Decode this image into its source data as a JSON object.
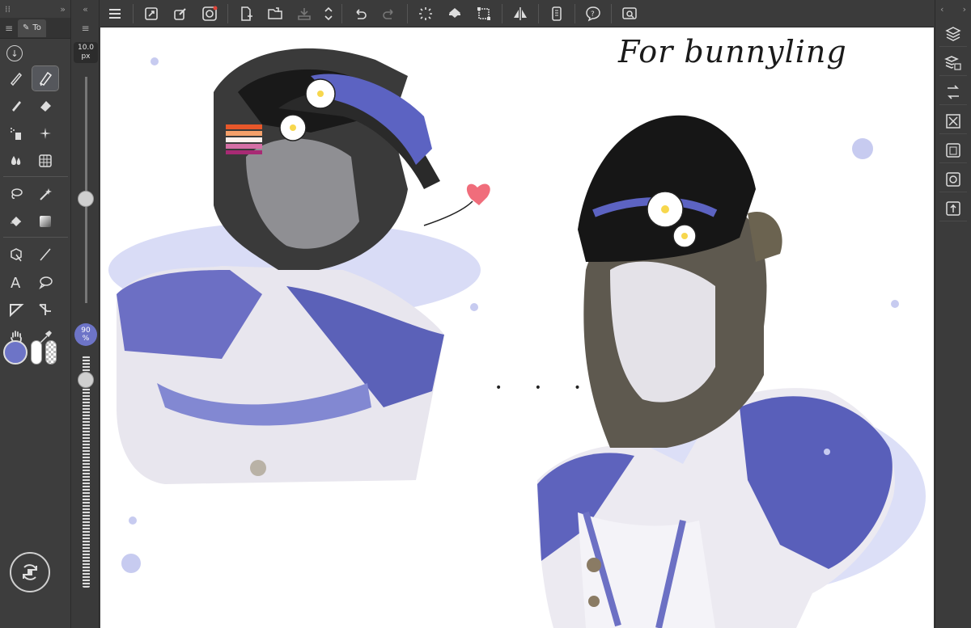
{
  "left_panel": {
    "collapse_glyph": "«",
    "expand_glyph": "»",
    "tab_label": "To",
    "tools": [
      [
        "pen-icon",
        "marker-icon"
      ],
      [
        "brush-icon",
        "eraser-icon"
      ],
      [
        "spray-icon",
        "sparkle-icon"
      ],
      [
        "blend-icon",
        "grid-icon"
      ],
      [
        "lasso-icon",
        "magic-wand-icon"
      ],
      [
        "fill-icon",
        "gradient-icon"
      ],
      [
        "object-icon",
        "line-icon"
      ],
      [
        "text-icon",
        "balloon-icon"
      ],
      [
        "frame-icon",
        "ruler-icon"
      ],
      [
        "hand-icon",
        "eyedropper-icon"
      ]
    ],
    "main_color": "#6d74c7",
    "sub_color": "#ffffff"
  },
  "size_panel": {
    "size_value": "10.0",
    "size_unit": "px",
    "opacity_value": "90",
    "opacity_unit": "%"
  },
  "toolbar": {
    "buttons": [
      "menu-icon",
      "resize-icon",
      "transform-icon",
      "spiral-icon",
      "new-file-icon",
      "open-folder-icon",
      "save-icon",
      "up-down-icon",
      "undo-icon",
      "redo-icon",
      "loading-icon",
      "fill-bucket-icon",
      "crop-icon",
      "flip-icon",
      "phone-icon",
      "help-icon",
      "search-icon"
    ]
  },
  "canvas": {
    "handwritten_text": "For bunnyling",
    "ellipsis": "• • •"
  },
  "right_panel": {
    "buttons": [
      "layers-icon",
      "layer-properties-icon",
      "navigator-icon",
      "material-icon",
      "subtool-icon",
      "color-icon",
      "history-icon"
    ]
  }
}
